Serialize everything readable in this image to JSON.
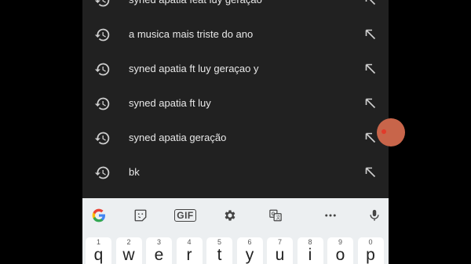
{
  "suggestions": [
    {
      "text": "syned apatia feat luy geração",
      "icon": "history-icon",
      "action_icon": "arrow-up-left-icon"
    },
    {
      "text": "a musica mais triste do ano",
      "icon": "history-icon",
      "action_icon": "arrow-up-left-icon"
    },
    {
      "text": "syned apatia ft luy geraçao y",
      "icon": "history-icon",
      "action_icon": "arrow-up-left-icon"
    },
    {
      "text": "syned apatia ft luy",
      "icon": "history-icon",
      "action_icon": "arrow-up-left-icon"
    },
    {
      "text": "syned apatia geração",
      "icon": "history-icon",
      "action_icon": "arrow-up-left-icon"
    },
    {
      "text": "bk",
      "icon": "history-icon",
      "action_icon": "arrow-up-left-icon"
    }
  ],
  "keyboard": {
    "toolbar": {
      "google": "google-icon",
      "sticker": "sticker-icon",
      "gif_label": "GIF",
      "settings": "gear-icon",
      "translate": "translate-icon",
      "more": "more-icon",
      "mic": "mic-icon"
    },
    "keys": [
      {
        "num": "1",
        "ch": "q"
      },
      {
        "num": "2",
        "ch": "w"
      },
      {
        "num": "3",
        "ch": "e"
      },
      {
        "num": "4",
        "ch": "r"
      },
      {
        "num": "5",
        "ch": "t"
      },
      {
        "num": "6",
        "ch": "y"
      },
      {
        "num": "7",
        "ch": "u"
      },
      {
        "num": "8",
        "ch": "i"
      },
      {
        "num": "9",
        "ch": "o"
      },
      {
        "num": "0",
        "ch": "p"
      }
    ]
  },
  "colors": {
    "background": "#000000",
    "panel": "#212121",
    "text": "#e8e8e8",
    "keyboard": "#eceff1",
    "overlay_dot": "#c8654a"
  }
}
